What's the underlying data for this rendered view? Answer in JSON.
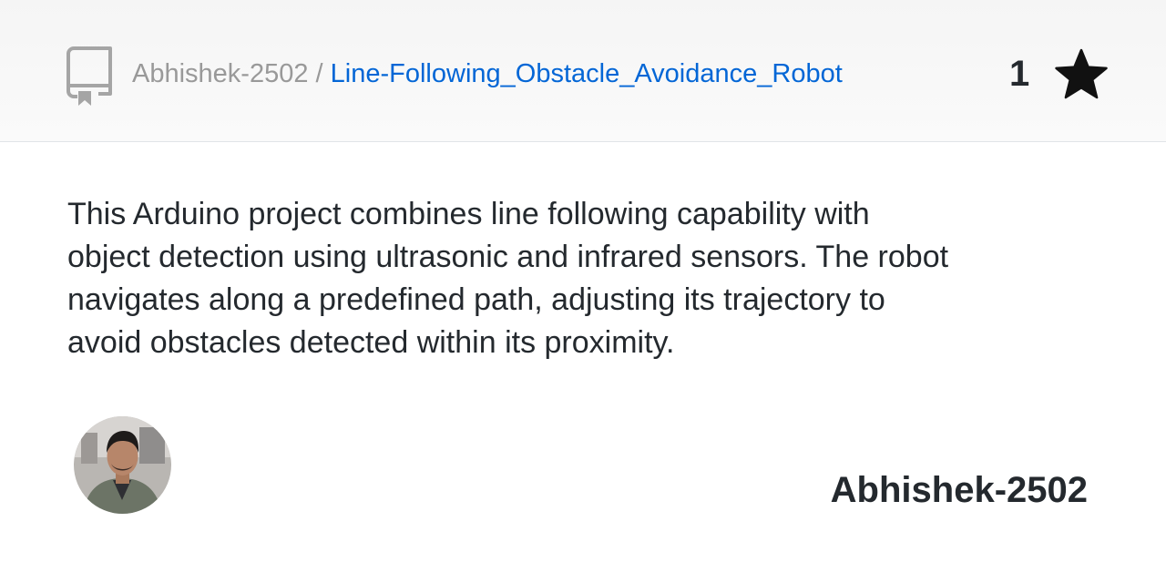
{
  "header": {
    "owner": "Abhishek-2502",
    "separator": " / ",
    "repo_name": "Line-Following_Obstacle_Avoidance_Robot",
    "star_count": "1",
    "icons": {
      "repo": "repo-icon",
      "star": "star-icon"
    }
  },
  "description": "This Arduino project combines line following capability with object detection using ultrasonic and infrared sensors. The robot navigates along a predefined path, adjusting its trajectory to avoid obstacles detected within its proximity.",
  "author": {
    "avatar": "avatar",
    "name": "Abhishek-2502"
  },
  "colors": {
    "link": "#0366d6",
    "muted": "#999999",
    "text": "#24292e"
  }
}
